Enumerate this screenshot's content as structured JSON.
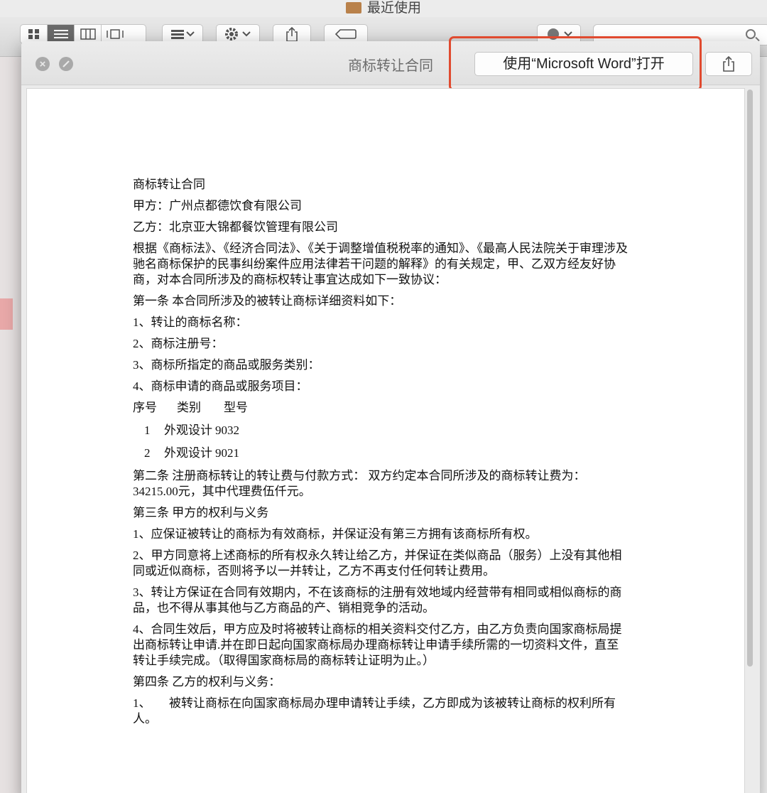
{
  "finder": {
    "title": "最近使用",
    "toolbar": {
      "view_icons": [
        "grid-view-icon",
        "list-view-icon",
        "column-view-icon",
        "gallery-view-icon"
      ],
      "active_view": "list-view-icon",
      "group_icon": "group-icon",
      "action_icon": "gear-icon",
      "share_icon": "share-icon",
      "tag_icon": "tag-icon",
      "search_icon": "search-icon"
    }
  },
  "quicklook": {
    "title": "商标转让合同",
    "open_button_label": "使用“Microsoft Word”打开",
    "close_icon": "close-icon",
    "fullscreen_icon": "fullscreen-icon",
    "share_icon": "share-icon",
    "highlight_color": "#e04a2f"
  },
  "document": {
    "title": "商标转让合同",
    "party_a": "甲方：广州点都德饮食有限公司",
    "party_b": "乙方：北京亚大锦都餐饮管理有限公司",
    "preamble": "根据《商标法》、《经济合同法》、《关于调整增值税税率的通知》、《最高人民法院关于审理涉及驰名商标保护的民事纠纷案件应用法律若干问题的解释》的有关规定，甲、乙双方经友好协商，对本合同所涉及的商标权转让事宜达成如下一致协议：",
    "article1": "第一条 本合同所涉及的被转让商标详细资料如下：",
    "a1_items": [
      "1、转让的商标名称：",
      "2、商标注册号：",
      "3、商标所指定的商品或服务类别：",
      "4、商标申请的商品或服务项目："
    ],
    "table_header": [
      "序号",
      "类别",
      "型号"
    ],
    "table_rows": [
      [
        "1",
        "外观设计",
        "9032"
      ],
      [
        "2",
        "外观设计",
        "9021"
      ]
    ],
    "article2": "第二条 注册商标转让的转让费与付款方式： 双方约定本合同所涉及的商标转让费为：34215.00元，其中代理费伍仟元。",
    "article3": "第三条 甲方的权利与义务",
    "a3_items": [
      "1、应保证被转让的商标为有效商标，并保证没有第三方拥有该商标所有权。",
      "2、甲方同意将上述商标的所有权永久转让给乙方，并保证在类似商品（服务）上没有其他相同或近似商标，否则将予以一并转让，乙方不再支付任何转让费用。",
      "3、转让方保证在合同有效期内，不在该商标的注册有效地域内经营带有相同或相似商标的商品，也不得从事其他与乙方商品的产、销相竞争的活动。",
      "4、合同生效后，甲方应及时将被转让商标的相关资料交付乙方，由乙方负责向国家商标局提出商标转让申请.并在即日起向国家商标局办理商标转让申请手续所需的一切资料文件，直至转让手续完成。（取得国家商标局的商标转让证明为止。）"
    ],
    "article4": "第四条 乙方的权利与义务：",
    "a4_items": [
      "1、　　被转让商标在向国家商标局办理申请转让手续，乙方即成为该被转让商标的权利所有人。"
    ]
  }
}
